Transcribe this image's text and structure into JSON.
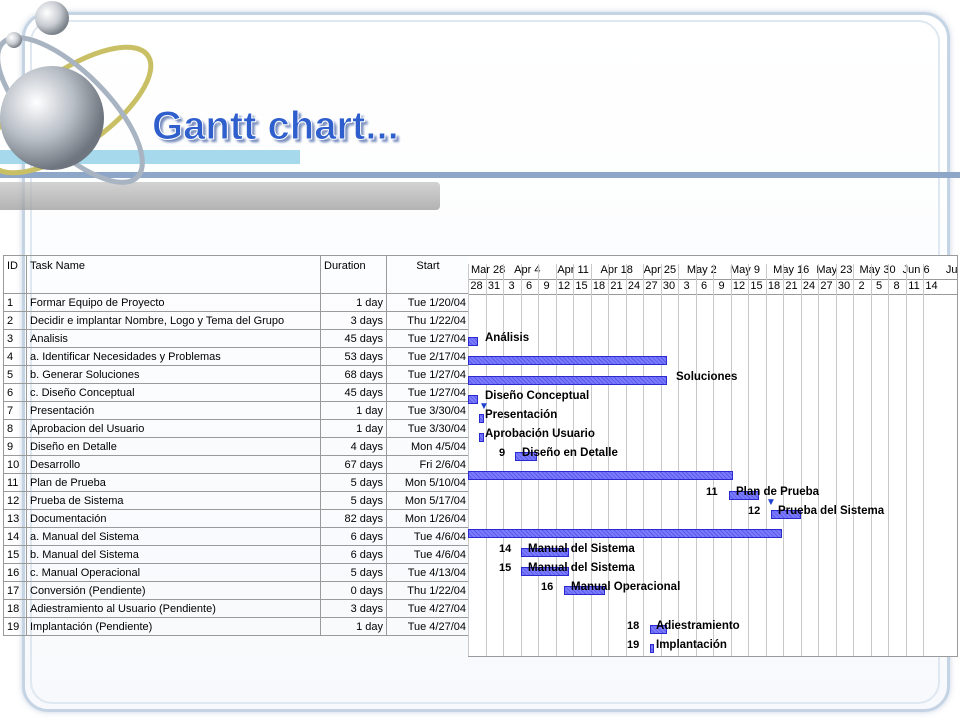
{
  "slide": {
    "title": "Gantt chart...",
    "colors": {
      "title": "#2f5fcc",
      "bar": "#6a6aff"
    }
  },
  "table": {
    "headers": {
      "id": "ID",
      "task": "Task Name",
      "duration": "Duration",
      "start": "Start"
    },
    "rows": [
      {
        "id": "1",
        "task": "Formar Equipo de Proyecto",
        "duration": "1 day",
        "start": "Tue 1/20/04",
        "indent": false
      },
      {
        "id": "2",
        "task": "Decidir e implantar Nombre, Logo y Tema del Grupo",
        "duration": "3 days",
        "start": "Thu 1/22/04",
        "indent": false
      },
      {
        "id": "3",
        "task": "Analisis",
        "duration": "45 days",
        "start": "Tue 1/27/04",
        "indent": false
      },
      {
        "id": "4",
        "task": "a.  Identificar Necesidades y Problemas",
        "duration": "53 days",
        "start": "Tue 2/17/04",
        "indent": true
      },
      {
        "id": "5",
        "task": "b.  Generar Soluciones",
        "duration": "68 days",
        "start": "Tue 1/27/04",
        "indent": true
      },
      {
        "id": "6",
        "task": "c.  Diseño Conceptual",
        "duration": "45 days",
        "start": "Tue 1/27/04",
        "indent": true
      },
      {
        "id": "7",
        "task": "Presentación",
        "duration": "1 day",
        "start": "Tue 3/30/04",
        "indent": false
      },
      {
        "id": "8",
        "task": "Aprobacion del Usuario",
        "duration": "1 day",
        "start": "Tue 3/30/04",
        "indent": false
      },
      {
        "id": "9",
        "task": "Diseño en Detalle",
        "duration": "4 days",
        "start": "Mon 4/5/04",
        "indent": false
      },
      {
        "id": "10",
        "task": "Desarrollo",
        "duration": "67 days",
        "start": "Fri 2/6/04",
        "indent": false
      },
      {
        "id": "11",
        "task": "Plan de Prueba",
        "duration": "5 days",
        "start": "Mon 5/10/04",
        "indent": false
      },
      {
        "id": "12",
        "task": "Prueba de Sistema",
        "duration": "5 days",
        "start": "Mon 5/17/04",
        "indent": false
      },
      {
        "id": "13",
        "task": "Documentación",
        "duration": "82 days",
        "start": "Mon 1/26/04",
        "indent": false
      },
      {
        "id": "14",
        "task": "a.  Manual del Sistema",
        "duration": "6 days",
        "start": "Tue 4/6/04",
        "indent": true
      },
      {
        "id": "15",
        "task": "b.  Manual del Sistema",
        "duration": "6 days",
        "start": "Tue 4/6/04",
        "indent": true
      },
      {
        "id": "16",
        "task": "c.  Manual Operacional",
        "duration": "5 days",
        "start": "Tue 4/13/04",
        "indent": true
      },
      {
        "id": "17",
        "task": "Conversión (Pendiente)",
        "duration": "0 days",
        "start": "Thu 1/22/04",
        "indent": false
      },
      {
        "id": "18",
        "task": "Adiestramiento al Usuario (Pendiente)",
        "duration": "3 days",
        "start": "Tue 4/27/04",
        "indent": false
      },
      {
        "id": "19",
        "task": "Implantación (Pendiente)",
        "duration": "1 day",
        "start": "Tue 4/27/04",
        "indent": false
      }
    ]
  },
  "timeline": {
    "weeks": [
      "Mar 28",
      "Apr 4",
      "Apr 11",
      "Apr 18",
      "Apr 25",
      "May 2",
      "May 9",
      "May 16",
      "May 23",
      "May 30",
      "Jun 6",
      "Jun"
    ],
    "days": [
      "28",
      "31",
      "3",
      "6",
      "9",
      "12",
      "15",
      "18",
      "21",
      "24",
      "27",
      "30",
      "3",
      "6",
      "9",
      "12",
      "15",
      "18",
      "21",
      "24",
      "27",
      "30",
      "2",
      "5",
      "8",
      "11",
      "14"
    ],
    "bar_labels": {
      "r3": "Análisis",
      "r5": "Soluciones",
      "r6": "Diseño Conceptual",
      "r7": "Presentación",
      "r8": "Aprobación Usuario",
      "r9": "Diseño en Detalle",
      "r11": "Plan de Prueba",
      "r12": "Prueba del Sistema",
      "r14": "Manual del Sistema",
      "r15": "Manual del Sistema",
      "r16": "Manual Operacional",
      "r18": "Adiestramiento",
      "r19": "Implantación"
    },
    "bar_numbers": {
      "r9": "9",
      "r11": "11",
      "r12": "12",
      "r14": "14",
      "r15": "15",
      "r16": "16",
      "r18": "18",
      "r19": "19"
    }
  }
}
